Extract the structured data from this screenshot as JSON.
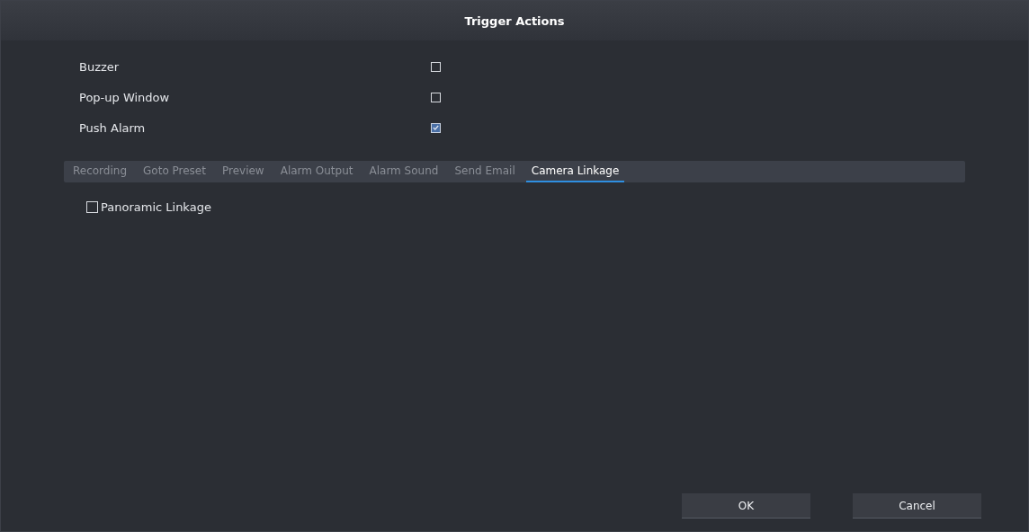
{
  "window": {
    "title": "Trigger Actions"
  },
  "options": [
    {
      "label": "Buzzer",
      "checked": false
    },
    {
      "label": "Pop-up Window",
      "checked": false
    },
    {
      "label": "Push Alarm",
      "checked": true
    }
  ],
  "tabs": [
    {
      "label": "Recording",
      "selected": false
    },
    {
      "label": "Goto Preset",
      "selected": false
    },
    {
      "label": "Preview",
      "selected": false
    },
    {
      "label": "Alarm Output",
      "selected": false
    },
    {
      "label": "Alarm Sound",
      "selected": false
    },
    {
      "label": "Send Email",
      "selected": false
    },
    {
      "label": "Camera Linkage",
      "selected": true
    }
  ],
  "tab_content": {
    "options": [
      {
        "label": "Panoramic Linkage",
        "checked": false
      }
    ]
  },
  "buttons": [
    {
      "label": "OK"
    },
    {
      "label": "Cancel"
    }
  ]
}
